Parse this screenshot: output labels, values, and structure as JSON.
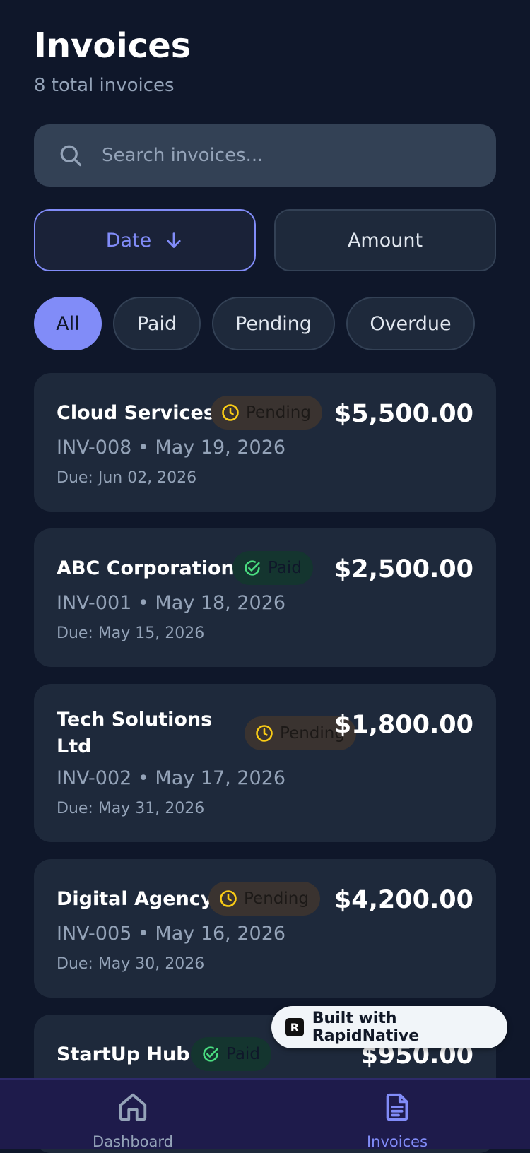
{
  "header": {
    "title": "Invoices",
    "subtitle": "8 total invoices"
  },
  "search": {
    "placeholder": "Search invoices..."
  },
  "sort": {
    "date_label": "Date",
    "amount_label": "Amount"
  },
  "filters": [
    "All",
    "Paid",
    "Pending",
    "Overdue"
  ],
  "invoices": [
    {
      "client": "Cloud Services",
      "status": "Pending",
      "amount": "$5,500.00",
      "meta": "INV-008 • May 19, 2026",
      "due": "Due: Jun 02, 2026"
    },
    {
      "client": "ABC Corporation",
      "status": "Paid",
      "amount": "$2,500.00",
      "meta": "INV-001 • May 18, 2026",
      "due": "Due: May 15, 2026"
    },
    {
      "client": "Tech Solutions Ltd",
      "status": "Pending",
      "amount": "$1,800.00",
      "meta": "INV-002 • May 17, 2026",
      "due": "Due: May 31, 2026"
    },
    {
      "client": "Digital Agency",
      "status": "Pending",
      "amount": "$4,200.00",
      "meta": "INV-005 • May 16, 2026",
      "due": "Due: May 30, 2026"
    },
    {
      "client": "StartUp Hub",
      "status": "Paid",
      "amount": "$950.00"
    }
  ],
  "built_with": "Built with RapidNative",
  "tabs": [
    {
      "label": "Dashboard",
      "icon": "home-icon"
    },
    {
      "label": "Invoices",
      "icon": "document-icon"
    }
  ],
  "colors": {
    "accent": "#818cf8",
    "background": "#0f172a",
    "card": "#1e293b",
    "pending": "#facc15",
    "paid": "#4ade80"
  }
}
